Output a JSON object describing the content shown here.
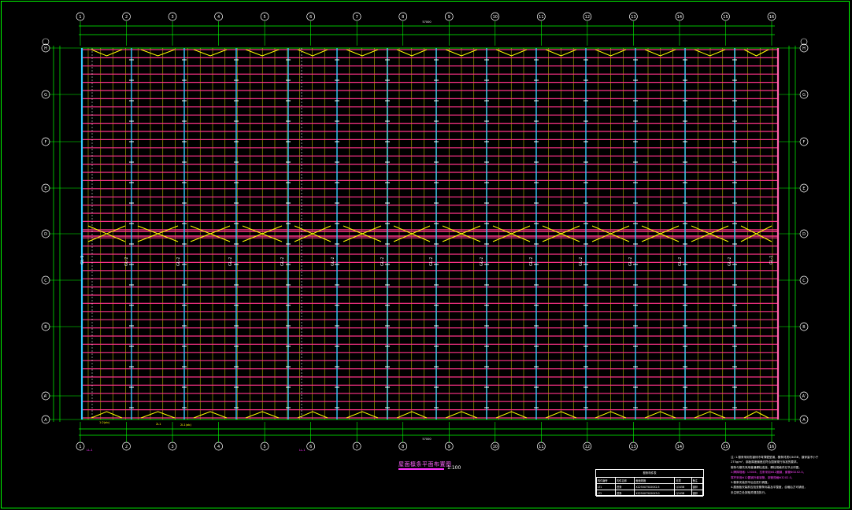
{
  "drawing": {
    "title": "屋面檩条平面布置图",
    "scale": "1:100",
    "overall_dimension_top": "57000",
    "overall_dimension_bottom": "57000"
  },
  "grid": {
    "columns": [
      "1",
      "2",
      "3",
      "4",
      "5",
      "6",
      "7",
      "8",
      "9",
      "10",
      "11",
      "12",
      "13",
      "14",
      "15",
      "16"
    ],
    "rows_top_to_bottom": [
      "H",
      "G",
      "F",
      "E",
      "D",
      "C",
      "B",
      "A'",
      "A"
    ]
  },
  "labels": {
    "gl_main": "GL-1",
    "gl_inner": [
      "GL-2",
      "GL-2",
      "GL-2",
      "GL-2",
      "GL-2",
      "GL-2",
      "GL-2",
      "GL-2",
      "GL-2",
      "GL-2",
      "GL-2",
      "GL-2",
      "GL-2"
    ],
    "bottom_callouts": [
      "1:2(ab)",
      "2L1",
      "2L1(ab)"
    ],
    "red_note_left": "LL-1",
    "red_note_mid": "LL-1"
  },
  "schedule": {
    "title": "檩条构件表",
    "headers": [
      "构件编号",
      "构件名称",
      "截面规格",
      "材质",
      "备注"
    ],
    "rows": [
      [
        "LT1",
        "檩条",
        "XZ250X75X20X2.5",
        "Q345B",
        "镀锌"
      ],
      [
        "LT2",
        "檩条",
        "XZ250X75X20X3.0",
        "Q345B",
        "镀锌"
      ]
    ]
  },
  "notes": [
    {
      "text": "注: 1.檩条采用热镀锌冷弯薄壁型钢，檩条材质Q345B，镀锌量不小于",
      "color": "#ffffff"
    },
    {
      "text": "   275g/m²，钢板厚度偏差应符合国家现行标准的要求。",
      "color": "#ffffff"
    },
    {
      "text": "   檩条与檩托采用普通螺栓连接，螺栓规格详见节点详图。",
      "color": "#ffffff"
    },
    {
      "text": "2.隅撑规格：L50X4，拉条采用Φ12圆钢，套管Φ32X2.0。",
      "color": "#ff44ff"
    },
    {
      "text": "   撑杆采用Φ12圆钢外套钢管，钢管规格Φ32X2.0。",
      "color": "#ff44ff"
    },
    {
      "text": "3.檩条安装完毕后应进行调直。",
      "color": "#ffffff"
    },
    {
      "text": "4.屋面板安装前应检查檩条标高及平整度，合格后方可铺设，",
      "color": "#ffffff"
    },
    {
      "text": "   未注明之处按相关规范执行。",
      "color": "#ffffff"
    }
  ],
  "colors": {
    "frame": "#00ff00",
    "grid_line": "#00ff00",
    "purlin": "#ff3388",
    "tie_rod": "#ffff00",
    "rafter": "#33ccff",
    "dimension": "#00ff00",
    "brace": "#ffff00",
    "text": "#ffffff",
    "highlight": "#ff33ff"
  }
}
